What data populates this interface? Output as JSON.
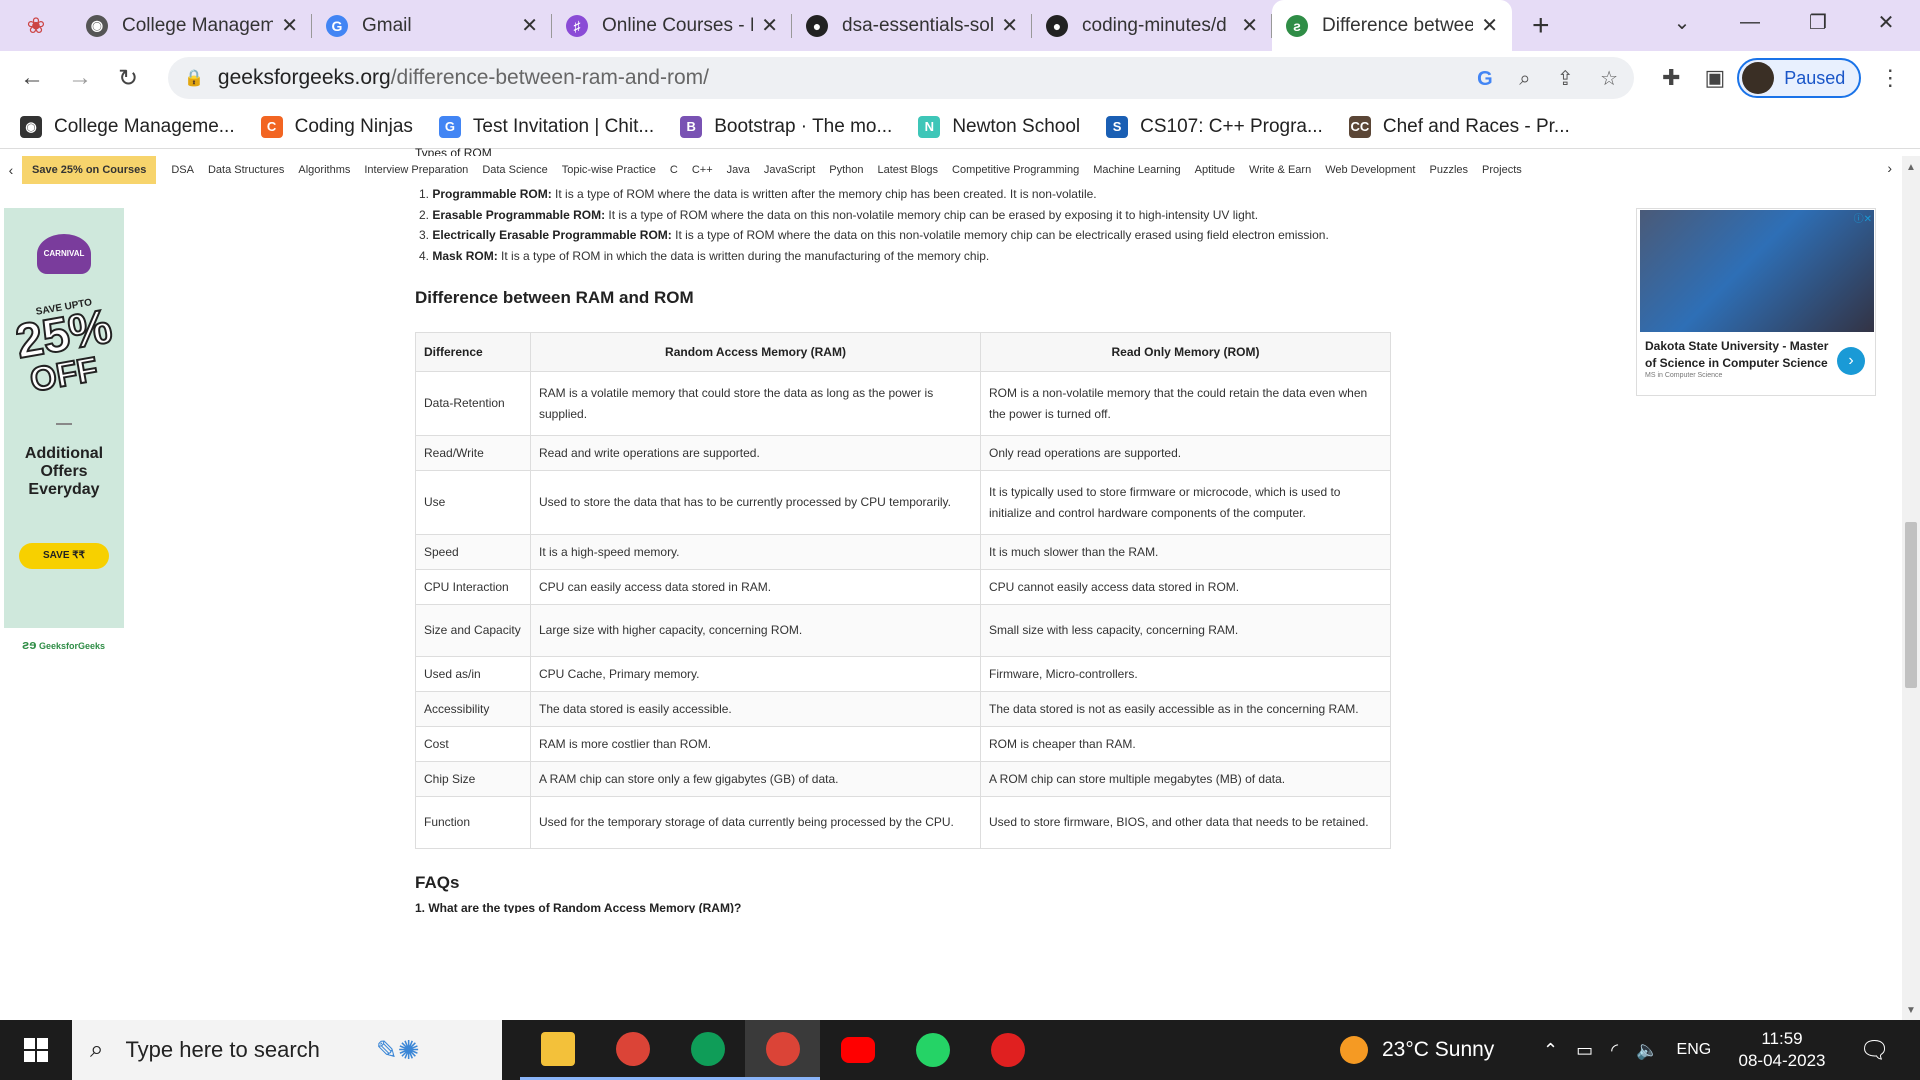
{
  "browser": {
    "tabs": [
      {
        "label": "College Managem",
        "color": "#555555",
        "glyph": "◉"
      },
      {
        "label": "Gmail",
        "color": "#4285f4",
        "glyph": "G"
      },
      {
        "label": "Online Courses - L",
        "color": "#8a4bd6",
        "glyph": "♯"
      },
      {
        "label": "dsa-essentials-sol",
        "color": "#222222",
        "glyph": "●"
      },
      {
        "label": "coding-minutes/d",
        "color": "#222222",
        "glyph": "●"
      },
      {
        "label": "Difference betwee",
        "color": "#2f8d46",
        "glyph": "ƨ"
      }
    ],
    "new_tab": "+",
    "url_host": "geeksforgeeks.org",
    "url_path": "/difference-between-ram-and-rom/",
    "profile_label": "Paused",
    "bookmarks": [
      {
        "label": "College Manageme...",
        "color": "#333333",
        "glyph": "◉"
      },
      {
        "label": "Coding Ninjas",
        "color": "#f26522",
        "glyph": "C"
      },
      {
        "label": "Test Invitation | Chit...",
        "color": "#4285f4",
        "glyph": "G"
      },
      {
        "label": "Bootstrap · The mo...",
        "color": "#7952b3",
        "glyph": "B"
      },
      {
        "label": "Newton School",
        "color": "#3ec6b8",
        "glyph": "N"
      },
      {
        "label": "CS107: C++ Progra...",
        "color": "#1a5fb4",
        "glyph": "S"
      },
      {
        "label": "Chef and Races - Pr...",
        "color": "#5b4636",
        "glyph": "CC"
      }
    ]
  },
  "subnav": {
    "promo": "Save 25% on Courses",
    "items": [
      "DSA",
      "Data Structures",
      "Algorithms",
      "Interview Preparation",
      "Data Science",
      "Topic-wise Practice",
      "C",
      "C++",
      "Java",
      "JavaScript",
      "Python",
      "Latest Blogs",
      "Competitive Programming",
      "Machine Learning",
      "Aptitude",
      "Write & Earn",
      "Web Development",
      "Puzzles",
      "Projects"
    ]
  },
  "left_ad": {
    "badge": "CARNIVAL",
    "save_upto": "SAVE UPTO",
    "percent": "25%",
    "off": "OFF",
    "additional": "Additional Offers Everyday",
    "button": "SAVE ₹₹",
    "logo": "GeeksforGeeks"
  },
  "right_ad": {
    "title": "Dakota State University - Master of Science in Computer Science",
    "subtitle": "MS in Computer Science"
  },
  "article": {
    "cut_heading": "Types of ROM",
    "rom_types": [
      {
        "num": "1.",
        "name": "Programmable ROM:",
        "desc": " It is a type of ROM where the data is written after the memory chip has been created. It is non-volatile."
      },
      {
        "num": "2.",
        "name": "Erasable Programmable ROM:",
        "desc": " It is a type of ROM where the data on this non-volatile memory chip can be erased by exposing it to high-intensity UV light."
      },
      {
        "num": "3.",
        "name": "Electrically Erasable Programmable ROM:",
        "desc": " It is a type of ROM where the data on this non-volatile memory chip can be electrically erased using field electron emission."
      },
      {
        "num": "4.",
        "name": "Mask ROM:",
        "desc": " It is a type of ROM in which the data is written during the manufacturing of the memory chip."
      }
    ],
    "section_title": "Difference between RAM and ROM",
    "table": {
      "headers": [
        "Difference",
        "Random Access Memory (RAM)",
        "Read Only Memory (ROM)"
      ],
      "rows": [
        [
          "Data-Retention",
          "RAM is a volatile memory that could store the data as long as the power is supplied.",
          "ROM is a non-volatile memory that the could retain the data even when the power is turned off."
        ],
        [
          "Read/Write",
          "Read and write operations are supported.",
          "Only read operations are supported."
        ],
        [
          "Use",
          "Used to store the data that has to be currently processed by CPU temporarily.",
          "It is typically used to store firmware or microcode, which is used to initialize and control hardware components of the computer."
        ],
        [
          "Speed",
          "It is a high-speed memory.",
          "It is much slower than the RAM."
        ],
        [
          "CPU Interaction",
          "CPU can easily access data stored in RAM.",
          "CPU cannot easily access data stored in ROM."
        ],
        [
          "Size and Capacity",
          "Large size with higher capacity, concerning ROM.",
          "Small size with less capacity, concerning RAM."
        ],
        [
          "Used as/in",
          "CPU Cache, Primary memory.",
          "Firmware, Micro-controllers."
        ],
        [
          "Accessibility",
          "The data stored is easily accessible.",
          "The data stored is not as easily accessible as in the concerning RAM."
        ],
        [
          "Cost",
          "RAM is more costlier than ROM.",
          "ROM is cheaper than RAM."
        ],
        [
          "Chip Size",
          "A RAM chip can store only a few gigabytes (GB) of data.",
          "A ROM chip can store multiple megabytes (MB) of data."
        ],
        [
          "Function",
          "Used for the temporary storage of data currently being processed by the CPU.",
          "Used to store firmware, BIOS, and other data that needs to be retained."
        ]
      ]
    },
    "faq_title": "FAQs",
    "faq_first": "1. What are the types of Random Access Memory (RAM)?"
  },
  "taskbar": {
    "search_placeholder": "Type here to search",
    "apps": [
      {
        "name": "file-explorer-icon",
        "color": "#f3c13a"
      },
      {
        "name": "chrome-icon",
        "color": "#db4437"
      },
      {
        "name": "chrome-profile-2-icon",
        "color": "#0f9d58"
      },
      {
        "name": "chrome-profile-3-icon",
        "color": "#db4437"
      },
      {
        "name": "youtube-icon",
        "color": "#ff0000"
      },
      {
        "name": "whatsapp-icon",
        "color": "#25d366"
      },
      {
        "name": "wps-office-icon",
        "color": "#e02020"
      }
    ],
    "weather": "23°C  Sunny",
    "language": "ENG",
    "time": "11:59",
    "date": "08-04-2023"
  }
}
